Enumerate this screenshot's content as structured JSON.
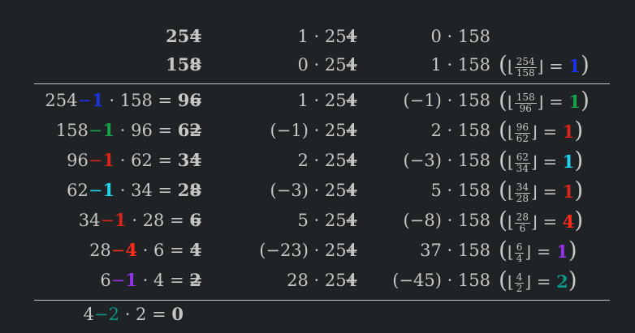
{
  "colors": {
    "blue": "#1a33e6",
    "green": "#16a34a",
    "red": "#d9261c",
    "cyan": "#22d3ee",
    "redbright": "#ff2a1a",
    "purple": "#9333ea",
    "teal": "#0d9488"
  },
  "symbols": {
    "eq": "=",
    "plus": "+",
    "times": "·",
    "minus": "−",
    "lfloor": "⌊",
    "rfloor": "⌋",
    "lparen": "(",
    "rparen": ")"
  },
  "header_rows": [
    {
      "lhs": "254",
      "c1": "1",
      "n1": "254",
      "c2": "0",
      "n2": "158"
    },
    {
      "lhs": "158",
      "c1": "0",
      "n1": "254",
      "c2": "1",
      "n2": "158",
      "q": {
        "num": "254",
        "den": "158",
        "val": "1",
        "color": "blue"
      }
    }
  ],
  "rows": [
    {
      "a": "254",
      "qv": "1",
      "color": "blue",
      "b": "158",
      "r": "96",
      "c1": "1",
      "n1": "254",
      "c2": "(−1)",
      "n2": "158",
      "fnum": "158",
      "fden": "96",
      "next": "1",
      "ncolor": "green"
    },
    {
      "a": "158",
      "qv": "1",
      "color": "green",
      "b": "96",
      "r": "62",
      "c1": "(−1)",
      "n1": "254",
      "c2": "2",
      "n2": "158",
      "fnum": "96",
      "fden": "62",
      "next": "1",
      "ncolor": "red"
    },
    {
      "a": "96",
      "qv": "1",
      "color": "red",
      "b": "62",
      "r": "34",
      "c1": "2",
      "n1": "254",
      "c2": "(−3)",
      "n2": "158",
      "fnum": "62",
      "fden": "34",
      "next": "1",
      "ncolor": "cyan"
    },
    {
      "a": "62",
      "qv": "1",
      "color": "cyan",
      "b": "34",
      "r": "28",
      "c1": "(−3)",
      "n1": "254",
      "c2": "5",
      "n2": "158",
      "fnum": "34",
      "fden": "28",
      "next": "1",
      "ncolor": "red"
    },
    {
      "a": "34",
      "qv": "1",
      "color": "red",
      "b": "28",
      "r": "6",
      "c1": "5",
      "n1": "254",
      "c2": "(−8)",
      "n2": "158",
      "fnum": "28",
      "fden": "6",
      "next": "4",
      "ncolor": "redbright"
    },
    {
      "a": "28",
      "qv": "4",
      "color": "redbright",
      "b": "6",
      "r": "4",
      "c1": "(−23)",
      "n1": "254",
      "c2": "37",
      "n2": "158",
      "fnum": "6",
      "fden": "4",
      "next": "1",
      "ncolor": "purple"
    },
    {
      "a": "6",
      "qv": "1",
      "color": "purple",
      "b": "4",
      "r": "2",
      "c1": "28",
      "n1": "254",
      "c2": "(−45)",
      "n2": "158",
      "fnum": "4",
      "fden": "2",
      "next": "2",
      "ncolor": "teal"
    }
  ],
  "final_row": {
    "a": "4",
    "qv": "2",
    "color": "teal",
    "b": "2",
    "r": "0"
  }
}
